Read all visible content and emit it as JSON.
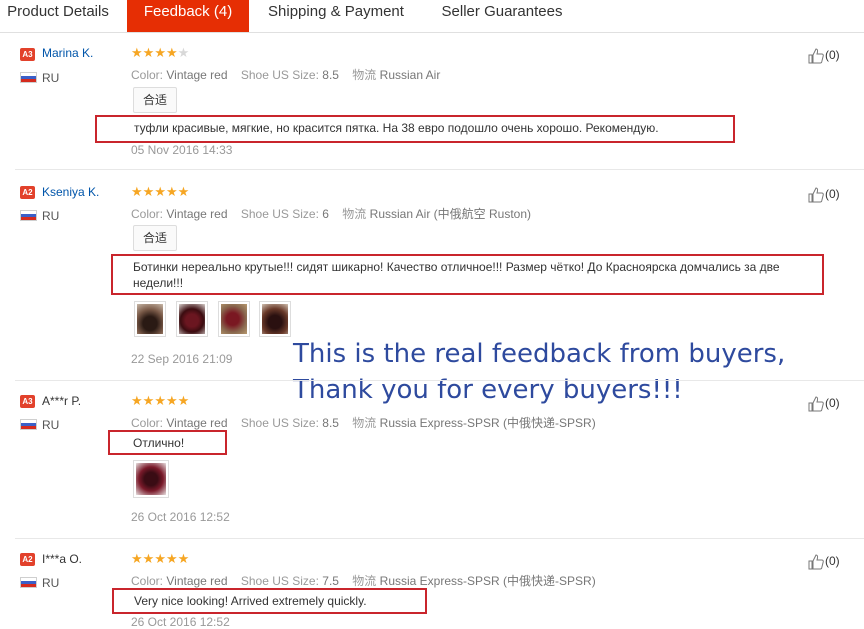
{
  "tabs": [
    {
      "label": "Product Details",
      "active": false
    },
    {
      "label": "Feedback (4)",
      "active": true
    },
    {
      "label": "Shipping & Payment",
      "active": false
    },
    {
      "label": "Seller Guarantees",
      "active": false
    }
  ],
  "labels": {
    "color": "Color:",
    "size": "Shoe US Size:",
    "shipping": "物流"
  },
  "reviews": [
    {
      "badge": "A3",
      "name": "Marina K.",
      "country": "RU",
      "rating": 4,
      "color": "Vintage red",
      "size": "8.5",
      "shipping": "Russian Air",
      "tag": "合适",
      "text": "туфли красивые, мягкие, но красится пятка. На 38 евро подошло очень хорошо. Рекомендую.",
      "date": "05 Nov 2016 14:33",
      "helpful": "(0)"
    },
    {
      "badge": "A2",
      "name": "Kseniya K.",
      "country": "RU",
      "rating": 5,
      "color": "Vintage red",
      "size": "6",
      "shipping": "Russian Air (中俄航空 Ruston)",
      "tag": "合适",
      "text_lines": [
        "Ботинки нереально крутые!!! сидят шикарно! Качество отличное!!! Размер чётко! До Красноярска домчались за две",
        "недели!!!"
      ],
      "photo_count": 4,
      "date": "22 Sep 2016 21:09",
      "helpful": "(0)"
    },
    {
      "badge": "A3",
      "name": "A***r P.",
      "country": "RU",
      "rating": 5,
      "color": "Vintage red",
      "size": "8.5",
      "shipping": "Russia Express-SPSR (中俄快递-SPSR)",
      "text": "Отлично!",
      "photo_count": 1,
      "date": "26 Oct 2016 12:52",
      "helpful": "(0)"
    },
    {
      "badge": "A2",
      "name": "I***a O.",
      "country": "RU",
      "rating": 5,
      "color": "Vintage red",
      "size": "7.5",
      "shipping": "Russia Express-SPSR (中俄快递-SPSR)",
      "text": "Very nice looking! Arrived extremely quickly.",
      "date": "26 Oct 2016 12:52",
      "helpful": "(0)"
    }
  ],
  "overlay": {
    "line1": "This is the real feedback from buyers,",
    "line2": "Thank you for every buyers!!!"
  },
  "colors": {
    "accent": "#e62e04",
    "star": "#f6a623",
    "highlight_border": "#c9252c",
    "overlay_text": "#2e4a9e"
  },
  "icons": {
    "helpful": "thumbs-up-icon",
    "flag": "russia-flag-icon"
  }
}
